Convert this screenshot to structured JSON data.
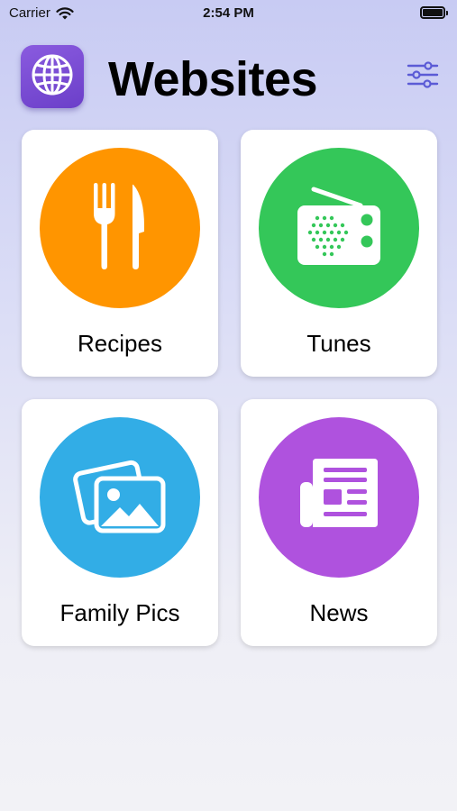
{
  "status_bar": {
    "carrier": "Carrier",
    "time": "2:54 PM",
    "wifi_icon": "wifi-icon",
    "battery_icon": "battery-icon"
  },
  "header": {
    "title": "Websites",
    "app_icon": "globe-icon",
    "filter_icon": "sliders-icon"
  },
  "tiles": [
    {
      "label": "Recipes",
      "icon": "fork-knife-icon",
      "color": "#ff9500"
    },
    {
      "label": "Tunes",
      "icon": "radio-icon",
      "color": "#34c759"
    },
    {
      "label": "Family Pics",
      "icon": "photos-icon",
      "color": "#32ade6"
    },
    {
      "label": "News",
      "icon": "newspaper-icon",
      "color": "#af52de"
    }
  ],
  "colors": {
    "accent": "#6b3fc9",
    "filter_icon": "#5b5bd6"
  }
}
